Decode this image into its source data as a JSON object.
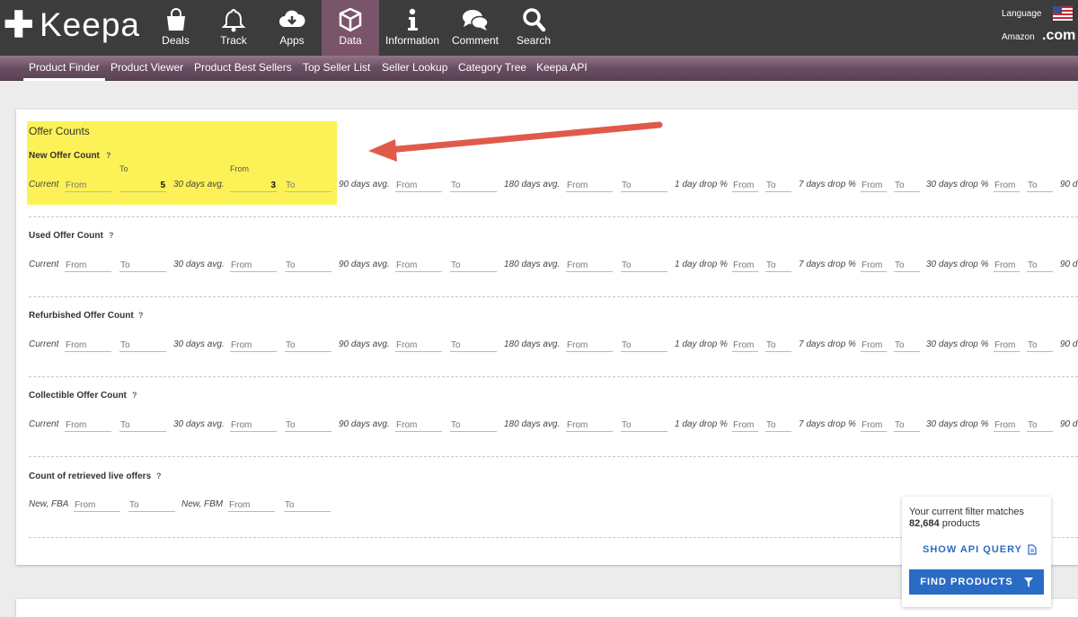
{
  "header": {
    "logo_text": "Keepa",
    "nav": [
      {
        "label": "Deals",
        "icon": "shopping-bag-icon"
      },
      {
        "label": "Track",
        "icon": "bell-icon"
      },
      {
        "label": "Apps",
        "icon": "cloud-download-icon"
      },
      {
        "label": "Data",
        "icon": "cube-icon",
        "active": true
      },
      {
        "label": "Information",
        "icon": "info-icon"
      },
      {
        "label": "Comment",
        "icon": "chat-bubbles-icon"
      },
      {
        "label": "Search",
        "icon": "search-icon"
      }
    ],
    "language_label": "Language",
    "amazon_label": "Amazon",
    "domain": ".com"
  },
  "subnav": [
    "Product Finder",
    "Product Viewer",
    "Product Best Sellers",
    "Top Seller List",
    "Seller Lookup",
    "Category Tree",
    "Keepa API"
  ],
  "panel": {
    "title": "Offer Counts",
    "question_mark": "?",
    "labels": {
      "current": "Current",
      "avg30": "30 days avg.",
      "avg90": "90 days avg.",
      "avg180": "180 days avg.",
      "drop1": "1 day drop %",
      "drop7": "7 days drop %",
      "drop30": "30 days drop %",
      "drop90": "90 d",
      "from": "From",
      "to": "To"
    },
    "sections": [
      {
        "title": "New Offer Count",
        "values": {
          "current_to": "5",
          "avg30_from": "3"
        }
      },
      {
        "title": "Used Offer Count"
      },
      {
        "title": "Refurbished Offer Count"
      },
      {
        "title": "Collectible Offer Count"
      }
    ],
    "live": {
      "title": "Count of retrieved live offers",
      "fba_label": "New, FBA",
      "fbm_label": "New, FBM"
    }
  },
  "filter_box": {
    "match_text": "Your current filter matches",
    "count": "82,684",
    "count_suffix": "products",
    "api_query_label": "SHOW API QUERY",
    "find_label": "FIND PRODUCTS"
  },
  "colors": {
    "header_bg": "#3c3c3c",
    "active_nav": "#7a5468",
    "highlight": "#fcf257",
    "arrow": "#e05a4a",
    "find_button": "#2a6bc6"
  }
}
